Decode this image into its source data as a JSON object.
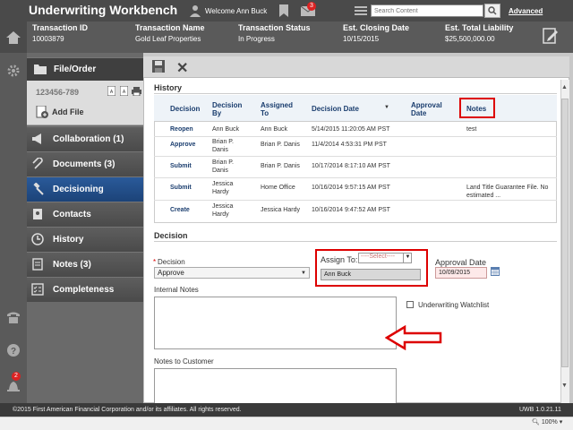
{
  "header": {
    "app_title": "Underwriting Workbench",
    "welcome": "Welcome Ann Buck",
    "mail_count": "3",
    "search_placeholder": "Search Content",
    "advanced_label": "Advanced"
  },
  "transaction": {
    "id_label": "Transaction ID",
    "id_value": "10003879",
    "name_label": "Transaction Name",
    "name_value": "Gold Leaf Properties",
    "status_label": "Transaction Status",
    "status_value": "In Progress",
    "closing_label": "Est. Closing Date",
    "closing_value": "10/15/2015",
    "liability_label": "Est. Total Liability",
    "liability_value": "$25,500,000.00"
  },
  "sidebar": {
    "file_order": "File/Order",
    "file_number": "123456-789",
    "add_file": "Add File",
    "items": [
      {
        "label": "Collaboration (1)",
        "icon": "megaphone-icon"
      },
      {
        "label": "Documents (3)",
        "icon": "paperclip-icon"
      },
      {
        "label": "Decisioning",
        "icon": "gavel-icon",
        "active": true
      },
      {
        "label": "Contacts",
        "icon": "address-book-icon"
      },
      {
        "label": "History",
        "icon": "clock-icon"
      },
      {
        "label": "Notes (3)",
        "icon": "note-icon"
      },
      {
        "label": "Completeness",
        "icon": "checklist-icon"
      }
    ]
  },
  "rail": {
    "notif_count": "2"
  },
  "history": {
    "title": "History",
    "columns": [
      "Decision",
      "Decision By",
      "Assigned To",
      "Decision Date",
      "Approval Date",
      "Notes"
    ],
    "rows": [
      {
        "decision": "Reopen",
        "by": "Ann Buck",
        "assigned": "Ann Buck",
        "date": "5/14/2015 11:20:05 AM PST",
        "approval": "",
        "notes": "test"
      },
      {
        "decision": "Approve",
        "by": "Brian P. Danis",
        "assigned": "Brian P. Danis",
        "date": "11/4/2014 4:53:31 PM PST",
        "approval": "",
        "notes": ""
      },
      {
        "decision": "Submit",
        "by": "Brian P. Danis",
        "assigned": "Brian P. Danis",
        "date": "10/17/2014 8:17:10 AM PST",
        "approval": "",
        "notes": ""
      },
      {
        "decision": "Submit",
        "by": "Jessica Hardy",
        "assigned": "Home Office",
        "date": "10/16/2014 9:57:15 AM PST",
        "approval": "",
        "notes": "Land Title Guarantee File. No estimated ..."
      },
      {
        "decision": "Create",
        "by": "Jessica Hardy",
        "assigned": "Jessica Hardy",
        "date": "10/16/2014 9:47:52 AM PST",
        "approval": "",
        "notes": ""
      }
    ]
  },
  "decision_form": {
    "title": "Decision",
    "decision_label": "Decision",
    "decision_value": "Approve",
    "assign_label": "Assign To:",
    "assign_select": "----Select----",
    "assign_value": "Ann Buck",
    "approval_label": "Approval Date",
    "approval_value": "10/09/2015",
    "internal_notes_label": "Internal Notes",
    "watchlist_label": "Underwriting Watchlist",
    "customer_notes_label": "Notes to Customer"
  },
  "footer": {
    "copyright": "©2015 First American Financial Corporation and/or its affiliates. All rights reserved.",
    "version": "UWB 1.0.21.11",
    "zoom": "100%"
  },
  "colors": {
    "accent": "#1c4378",
    "highlight": "#dd0000"
  }
}
